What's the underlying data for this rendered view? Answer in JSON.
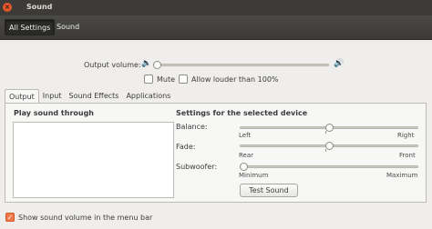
{
  "window": {
    "title": "Sound",
    "close_glyph": "×"
  },
  "toolbar": {
    "all_settings": "All Settings",
    "sound": "Sound"
  },
  "output_volume": {
    "label": "Output volume:",
    "icon_low": "🔈",
    "icon_high": "🔊",
    "level": 0.0,
    "mute_label": "Mute",
    "louder_label": "Allow louder than 100%",
    "mute_checked": false,
    "louder_checked": false
  },
  "tabs": [
    "Output",
    "Input",
    "Sound Effects",
    "Applications"
  ],
  "active_tab": "Output",
  "panel": {
    "play_through_label": "Play sound through",
    "settings_label": "Settings for the selected device",
    "balance": {
      "label": "Balance:",
      "left": "Left",
      "right": "Right",
      "level": 0.5
    },
    "fade": {
      "label": "Fade:",
      "left": "Rear",
      "right": "Front",
      "level": 0.5
    },
    "subwoofer": {
      "label": "Subwoofer:",
      "left": "Minimum",
      "right": "Maximum",
      "level": 0.0
    },
    "test_button": "Test Sound"
  },
  "menu_bar": {
    "label": "Show sound volume in the menu bar",
    "checked": true,
    "check_glyph": "✓"
  }
}
